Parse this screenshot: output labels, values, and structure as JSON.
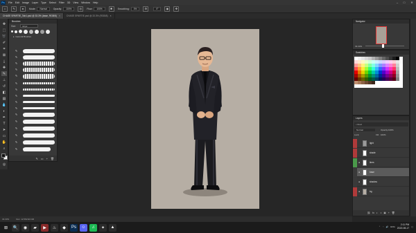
{
  "app": {
    "logo": "Ps"
  },
  "menu": [
    "File",
    "Edit",
    "Image",
    "Layer",
    "Type",
    "Select",
    "Filter",
    "3D",
    "View",
    "Window",
    "Help"
  ],
  "window_controls": {
    "minimize": "–",
    "maximize": "□",
    "close": "✕"
  },
  "options": {
    "mode_label": "Mode:",
    "mode_value": "Normal",
    "opacity_label": "Opacity:",
    "opacity_value": "100%",
    "flow_label": "Flow:",
    "flow_value": "100%",
    "smoothing_label": "Smoothing:",
    "smoothing_value": "0%",
    "angle_value": "0°"
  },
  "tabs": [
    {
      "label": "CHASE SPARTIE_Tab1.psd @ 33.3% (base, RGB/8)",
      "close": "×",
      "active": true
    },
    {
      "label": "CHASE SPARTIE.psd @ 33.3% (RGB/8)",
      "close": "×",
      "active": false
    }
  ],
  "brushes_panel": {
    "title": "Brushes",
    "size_label": "Size:",
    "size_value": "10 px",
    "group_label": "General Brushes",
    "group_arrow": "▸",
    "footer_icons": [
      "✎",
      "▭",
      "+",
      "🗑"
    ]
  },
  "status": {
    "zoom": "33.33%",
    "doc": "Doc: 12.5M/116.0M"
  },
  "navigator": {
    "title": "Navigator",
    "zoom": "33.33%"
  },
  "swatches": {
    "title": "Swatches",
    "colors": [
      "#ffffff",
      "#f2f2f2",
      "#e6e6e6",
      "#d9d9d9",
      "#cccccc",
      "#b3b3b3",
      "#999999",
      "#808080",
      "#666666",
      "#4d4d4d",
      "#333333",
      "#1a1a1a",
      "#000000",
      "#f7f7f7",
      "#ffd9d9",
      "#ffe8cc",
      "#fff8c2",
      "#e8ffc9",
      "#ccffd9",
      "#c9fff4",
      "#cceeff",
      "#ccd9ff",
      "#dccbff",
      "#f0ccff",
      "#ffccee",
      "#ffccd6",
      "#e6e6e6",
      "#f9f9f9",
      "#ff9999",
      "#ffc480",
      "#fff27a",
      "#c6ff80",
      "#80ffa3",
      "#80ffe5",
      "#80d4ff",
      "#8099ff",
      "#ad80ff",
      "#e080ff",
      "#ff80d4",
      "#ff8099",
      "#d0d0d0",
      "#ffffff",
      "#ff4d4d",
      "#ff9f33",
      "#ffeb33",
      "#9eff33",
      "#33ff6b",
      "#33ffd6",
      "#33b8ff",
      "#3366ff",
      "#7f33ff",
      "#d033ff",
      "#ff33bb",
      "#ff3366",
      "#bcbcbc",
      "#ffffff",
      "#e60000",
      "#e67a00",
      "#e6d200",
      "#6fd600",
      "#00cc3d",
      "#00ccaa",
      "#008fd6",
      "#0033cc",
      "#5500cc",
      "#a300cc",
      "#cc0088",
      "#cc0033",
      "#a8a8a8",
      "#ffffff",
      "#a60000",
      "#a65700",
      "#a69800",
      "#4f9900",
      "#008f2a",
      "#008f77",
      "#0065a0",
      "#002490",
      "#3c0090",
      "#740090",
      "#900060",
      "#900024",
      "#949494",
      "#ffffff",
      "#660000",
      "#663600",
      "#665d00",
      "#305e00",
      "#00581a",
      "#005849",
      "#003e62",
      "#001658",
      "#250058",
      "#470058",
      "#58003b",
      "#580016",
      "#7f7f7f",
      "#ffffff",
      "#c09070",
      "#a87a5a",
      "#8d6246",
      "#704c35",
      "#553827",
      "#3d271b",
      "#ffffff",
      "#ffffff",
      "#ffffff",
      "#ffffff",
      "#ffffff",
      "#ffffff",
      "#ffffff",
      "#ffffff",
      "#ffffff",
      "#ffffff",
      "#ffffff",
      "#ffffff",
      "#ffffff",
      "#ffffff",
      "#ffffff",
      "#ffffff",
      "#ffffff",
      "#ffffff",
      "#ffffff",
      "#ffffff",
      "#ffffff",
      "#ffffff"
    ]
  },
  "layers_panel": {
    "title": "Layers",
    "filter_label": "Kind",
    "blend_mode": "Normal",
    "opacity_label": "Opacity:",
    "opacity_value": "100%",
    "lock_label": "Lock:",
    "fill_label": "Fill:",
    "fill_value": "100%",
    "layers": [
      {
        "name": "light",
        "color": "#b03a3a",
        "eye": "",
        "thumb": "#9a9a9a",
        "selected": false
      },
      {
        "name": "shade",
        "color": "#b03a3a",
        "eye": "",
        "thumb": "#ffffff",
        "selected": false
      },
      {
        "name": "lines",
        "color": "#4a9a4a",
        "eye": "●",
        "thumb": "#ffffff",
        "selected": false
      },
      {
        "name": "base",
        "color": "#3a3a3a",
        "eye": "●",
        "thumb": "#ffffff",
        "selected": true
      },
      {
        "name": "shadow",
        "color": "#3a3a3a",
        "eye": "●",
        "thumb": "#ffffff",
        "selected": false
      },
      {
        "name": "bg",
        "color": "#b03a3a",
        "eye": "●",
        "thumb": "#b6aea4",
        "selected": false
      }
    ],
    "footer_icons": [
      "⛓",
      "fx",
      "◐",
      "◑",
      "▣",
      "+",
      "🗑"
    ]
  },
  "taskbar": {
    "start_icon": "⊞",
    "apps": [
      {
        "name": "search-icon",
        "glyph": "🔍",
        "color": "#2b2b2b"
      },
      {
        "name": "chrome-icon",
        "glyph": "◉",
        "color": "#2b2b2b"
      },
      {
        "name": "folder-icon",
        "glyph": "▰",
        "color": "#2b2b2b"
      },
      {
        "name": "media-icon",
        "glyph": "▶",
        "color": "#8a2b2b"
      },
      {
        "name": "steam-icon",
        "glyph": "♨",
        "color": "#2b2b2b"
      },
      {
        "name": "app-icon",
        "glyph": "◆",
        "color": "#2b2b2b"
      },
      {
        "name": "photoshop-icon",
        "glyph": "Ps",
        "color": "#0a2d52"
      },
      {
        "name": "discord-icon",
        "glyph": "☺",
        "color": "#5865f2"
      },
      {
        "name": "spotify-icon",
        "glyph": "♫",
        "color": "#1db954"
      },
      {
        "name": "app2-icon",
        "glyph": "✦",
        "color": "#2b2b2b"
      },
      {
        "name": "app3-icon",
        "glyph": "▲",
        "color": "#2b2b2b"
      }
    ],
    "tray_text": "ENG",
    "time": "2:11 PM",
    "date": "2022-08-17"
  }
}
